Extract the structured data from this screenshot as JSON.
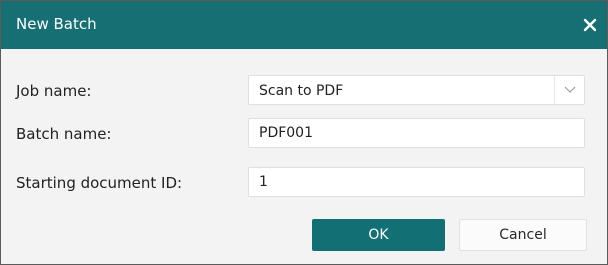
{
  "dialog": {
    "title": "New Batch",
    "close_icon": "close-icon",
    "accent_color": "#156f73"
  },
  "form": {
    "job_name": {
      "label": "Job name:",
      "value": "Scan to PDF",
      "icon": "chevron-down-icon"
    },
    "batch_name": {
      "label": "Batch name:",
      "value": "PDF001"
    },
    "starting_document_id": {
      "label": "Starting document ID:",
      "value": "1"
    }
  },
  "buttons": {
    "ok": "OK",
    "cancel": "Cancel"
  }
}
